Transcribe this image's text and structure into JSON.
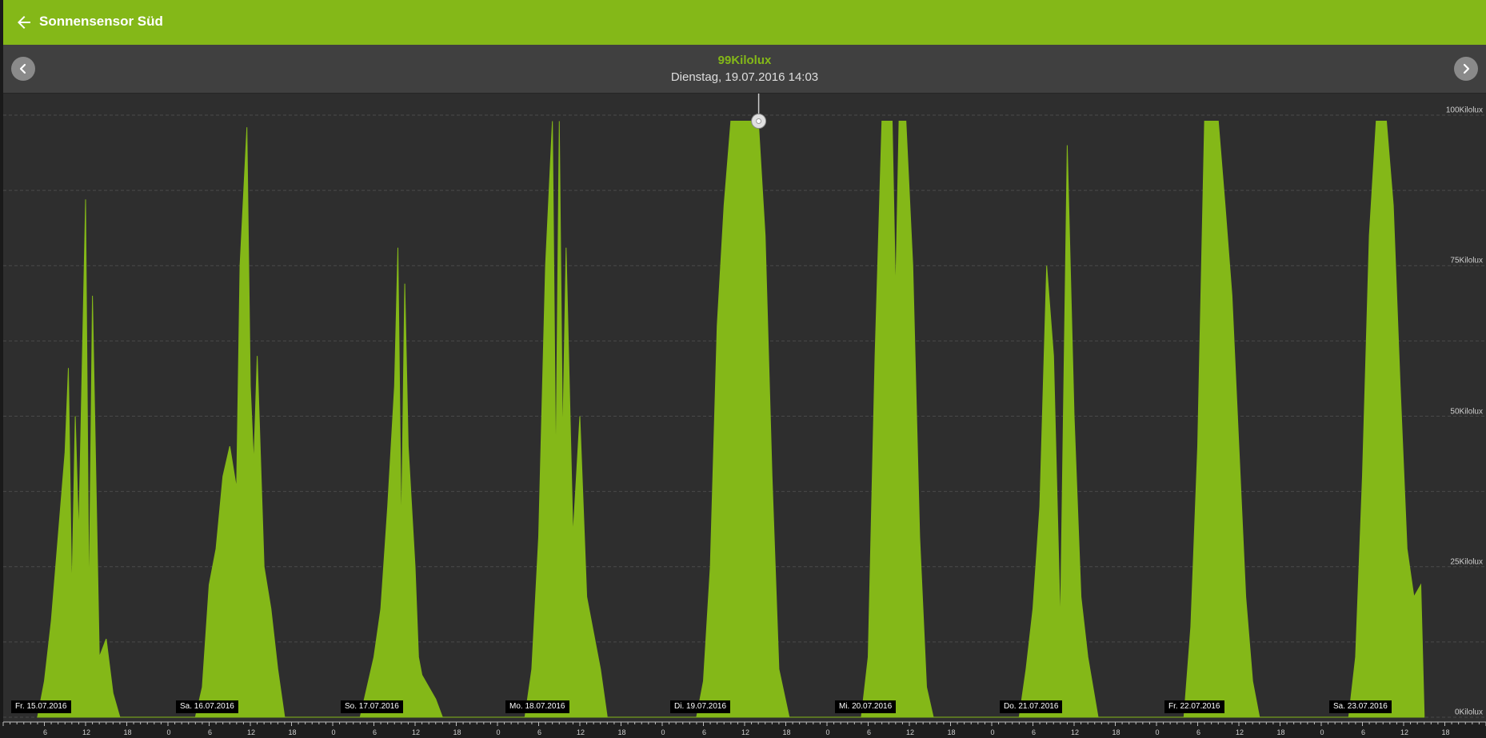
{
  "app": {
    "title": "Sonnensensor Süd"
  },
  "nav": {
    "value": "99Kilolux",
    "date": "Dienstag, 19.07.2016 14:03"
  },
  "colors": {
    "accent": "#84b818",
    "background": "#2e2e2e",
    "navbar": "#404040"
  },
  "icons": {
    "back": "arrow-left-icon",
    "prev": "chevron-left-icon",
    "next": "chevron-right-icon"
  },
  "chart_data": {
    "type": "area",
    "title": "",
    "xlabel": "",
    "ylabel": "",
    "unit": "Kilolux",
    "ylim": [
      0,
      100
    ],
    "grid": true,
    "y_ticks": [
      "0Kilolux",
      "25Kilolux",
      "50Kilolux",
      "75Kilolux",
      "100Kilolux"
    ],
    "x_range": [
      "2016-07-15T00:00",
      "2016-07-24T00:00"
    ],
    "day_labels": [
      {
        "date": "2016-07-15",
        "label": "Fr. 15.07.2016"
      },
      {
        "date": "2016-07-16",
        "label": "Sa. 16.07.2016"
      },
      {
        "date": "2016-07-17",
        "label": "So. 17.07.2016"
      },
      {
        "date": "2016-07-18",
        "label": "Mo. 18.07.2016"
      },
      {
        "date": "2016-07-19",
        "label": "Di. 19.07.2016"
      },
      {
        "date": "2016-07-20",
        "label": "Mi. 20.07.2016"
      },
      {
        "date": "2016-07-21",
        "label": "Do. 21.07.2016"
      },
      {
        "date": "2016-07-22",
        "label": "Fr. 22.07.2016"
      },
      {
        "date": "2016-07-23",
        "label": "Sa. 23.07.2016"
      }
    ],
    "hour_tick_labels": [
      "0",
      "6",
      "12",
      "18"
    ],
    "selected_point": {
      "time": "2016-07-19T14:03",
      "value": 99
    },
    "series": [
      {
        "values": [
          [
            "2016-07-15T05:00",
            0
          ],
          [
            "2016-07-15T06:00",
            6
          ],
          [
            "2016-07-15T07:00",
            16
          ],
          [
            "2016-07-15T08:00",
            30
          ],
          [
            "2016-07-15T09:00",
            44
          ],
          [
            "2016-07-15T09:30",
            58
          ],
          [
            "2016-07-15T10:00",
            20
          ],
          [
            "2016-07-15T10:30",
            50
          ],
          [
            "2016-07-15T11:00",
            30
          ],
          [
            "2016-07-15T12:00",
            86
          ],
          [
            "2016-07-15T12:30",
            18
          ],
          [
            "2016-07-15T13:00",
            70
          ],
          [
            "2016-07-15T14:00",
            10
          ],
          [
            "2016-07-15T15:00",
            13
          ],
          [
            "2016-07-15T16:00",
            4
          ],
          [
            "2016-07-15T17:00",
            0
          ],
          [
            "2016-07-16T04:00",
            0
          ],
          [
            "2016-07-16T05:00",
            5
          ],
          [
            "2016-07-16T06:00",
            22
          ],
          [
            "2016-07-16T07:00",
            28
          ],
          [
            "2016-07-16T08:00",
            40
          ],
          [
            "2016-07-16T09:00",
            45
          ],
          [
            "2016-07-16T10:00",
            38
          ],
          [
            "2016-07-16T10:30",
            75
          ],
          [
            "2016-07-16T11:30",
            98
          ],
          [
            "2016-07-16T12:00",
            55
          ],
          [
            "2016-07-16T12:30",
            42
          ],
          [
            "2016-07-16T13:00",
            60
          ],
          [
            "2016-07-16T14:00",
            25
          ],
          [
            "2016-07-16T15:00",
            18
          ],
          [
            "2016-07-16T16:00",
            8
          ],
          [
            "2016-07-16T17:00",
            0
          ],
          [
            "2016-07-17T04:00",
            0
          ],
          [
            "2016-07-17T05:00",
            5
          ],
          [
            "2016-07-17T06:00",
            10
          ],
          [
            "2016-07-17T07:00",
            18
          ],
          [
            "2016-07-17T08:00",
            35
          ],
          [
            "2016-07-17T09:00",
            55
          ],
          [
            "2016-07-17T09:30",
            78
          ],
          [
            "2016-07-17T10:00",
            30
          ],
          [
            "2016-07-17T10:30",
            72
          ],
          [
            "2016-07-17T11:00",
            45
          ],
          [
            "2016-07-17T12:00",
            25
          ],
          [
            "2016-07-17T12:30",
            10
          ],
          [
            "2016-07-17T13:00",
            7
          ],
          [
            "2016-07-17T15:00",
            3
          ],
          [
            "2016-07-17T16:00",
            0
          ],
          [
            "2016-07-18T04:00",
            0
          ],
          [
            "2016-07-18T05:00",
            8
          ],
          [
            "2016-07-18T06:00",
            30
          ],
          [
            "2016-07-18T07:00",
            75
          ],
          [
            "2016-07-18T08:00",
            99
          ],
          [
            "2016-07-18T08:30",
            40
          ],
          [
            "2016-07-18T09:00",
            99
          ],
          [
            "2016-07-18T09:30",
            45
          ],
          [
            "2016-07-18T10:00",
            78
          ],
          [
            "2016-07-18T11:00",
            30
          ],
          [
            "2016-07-18T12:00",
            50
          ],
          [
            "2016-07-18T13:00",
            20
          ],
          [
            "2016-07-18T15:00",
            8
          ],
          [
            "2016-07-18T16:00",
            0
          ],
          [
            "2016-07-19T05:00",
            0
          ],
          [
            "2016-07-19T06:00",
            6
          ],
          [
            "2016-07-19T07:00",
            25
          ],
          [
            "2016-07-19T08:00",
            65
          ],
          [
            "2016-07-19T09:00",
            85
          ],
          [
            "2016-07-19T10:00",
            99
          ],
          [
            "2016-07-19T14:00",
            99
          ],
          [
            "2016-07-19T15:00",
            80
          ],
          [
            "2016-07-19T16:00",
            40
          ],
          [
            "2016-07-19T17:00",
            8
          ],
          [
            "2016-07-19T18:30",
            0
          ],
          [
            "2016-07-20T05:00",
            0
          ],
          [
            "2016-07-20T06:00",
            10
          ],
          [
            "2016-07-20T07:00",
            60
          ],
          [
            "2016-07-20T08:00",
            99
          ],
          [
            "2016-07-20T09:30",
            99
          ],
          [
            "2016-07-20T10:00",
            70
          ],
          [
            "2016-07-20T10:30",
            99
          ],
          [
            "2016-07-20T11:30",
            99
          ],
          [
            "2016-07-20T12:30",
            75
          ],
          [
            "2016-07-20T13:30",
            30
          ],
          [
            "2016-07-20T14:30",
            5
          ],
          [
            "2016-07-20T15:30",
            0
          ],
          [
            "2016-07-21T04:00",
            0
          ],
          [
            "2016-07-21T05:00",
            8
          ],
          [
            "2016-07-21T06:00",
            18
          ],
          [
            "2016-07-21T07:00",
            35
          ],
          [
            "2016-07-21T08:00",
            75
          ],
          [
            "2016-07-21T09:00",
            60
          ],
          [
            "2016-07-21T10:00",
            15
          ],
          [
            "2016-07-21T11:00",
            95
          ],
          [
            "2016-07-21T12:00",
            50
          ],
          [
            "2016-07-21T13:00",
            20
          ],
          [
            "2016-07-21T14:00",
            10
          ],
          [
            "2016-07-21T15:30",
            0
          ],
          [
            "2016-07-22T04:00",
            0
          ],
          [
            "2016-07-22T05:00",
            15
          ],
          [
            "2016-07-22T06:00",
            45
          ],
          [
            "2016-07-22T07:00",
            99
          ],
          [
            "2016-07-22T08:00",
            99
          ],
          [
            "2016-07-22T09:00",
            99
          ],
          [
            "2016-07-22T10:00",
            85
          ],
          [
            "2016-07-22T11:00",
            70
          ],
          [
            "2016-07-22T12:00",
            45
          ],
          [
            "2016-07-22T13:00",
            20
          ],
          [
            "2016-07-22T14:00",
            6
          ],
          [
            "2016-07-22T15:00",
            0
          ],
          [
            "2016-07-23T04:00",
            0
          ],
          [
            "2016-07-23T05:00",
            10
          ],
          [
            "2016-07-23T06:00",
            40
          ],
          [
            "2016-07-23T07:00",
            80
          ],
          [
            "2016-07-23T08:00",
            99
          ],
          [
            "2016-07-23T09:30",
            99
          ],
          [
            "2016-07-23T10:30",
            85
          ],
          [
            "2016-07-23T11:30",
            55
          ],
          [
            "2016-07-23T12:30",
            28
          ],
          [
            "2016-07-23T13:30",
            20
          ],
          [
            "2016-07-23T14:30",
            22
          ],
          [
            "2016-07-23T15:00",
            0
          ]
        ]
      }
    ]
  }
}
